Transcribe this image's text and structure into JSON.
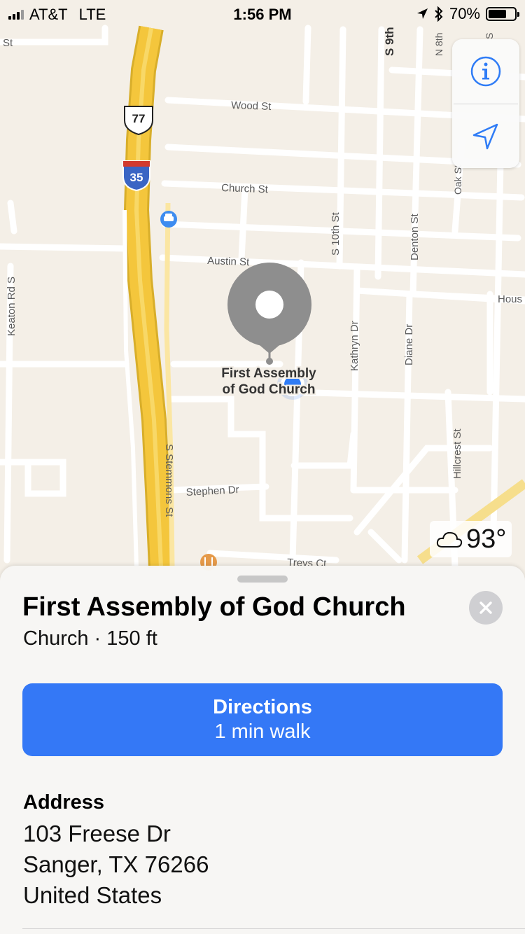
{
  "status_bar": {
    "carrier": "AT&T",
    "network": "LTE",
    "time": "1:56 PM",
    "battery": "70%",
    "battery_level": 0.7,
    "icons": [
      "signal-icon",
      "location-arrow-icon",
      "bluetooth-icon",
      "battery-icon"
    ]
  },
  "map": {
    "street_labels": {
      "st_top_left": "St",
      "s9th": "S 9th",
      "n8th": "N 8th",
      "s_right": "S",
      "wood": "Wood St",
      "church": "Church St",
      "austin": "Austin St",
      "s10th": "S 10th St",
      "denton": "Denton St",
      "oak": "Oak St",
      "hous": "Hous",
      "keaton": "Keaton Rd S",
      "kathryn": "Kathryn Dr",
      "diane": "Diane Dr",
      "hillcrest": "Hillcrest St",
      "stemmons": "S Stemmons St",
      "stephen": "Stephen Dr",
      "treys": "Treys Ct"
    },
    "shields": {
      "us_route": "77",
      "interstate": "35"
    },
    "poi_label_line1": "First Assembly",
    "poi_label_line2": "of God Church",
    "icons": [
      "car-service-icon",
      "restaurant-icon",
      "place-pin-icon",
      "user-location-icon"
    ],
    "colors": {
      "land": "#f4efe7",
      "road": "#ffffff",
      "highway": "#f4c63c",
      "pin": "#8e8e8e",
      "user_dot": "#2f7cf6"
    }
  },
  "controls": {
    "info_icon": "info-icon",
    "location_icon": "location-arrow-icon"
  },
  "weather": {
    "temperature": "93°",
    "icon": "cloud-icon"
  },
  "sheet": {
    "title": "First Assembly of God Church",
    "subtitle": "Church · 150 ft",
    "directions_label": "Directions",
    "directions_detail": "1 min walk",
    "address_label": "Address",
    "address_line1": "103 Freese Dr",
    "address_line2": "Sanger, TX  76266",
    "address_line3": "United States",
    "accent": "#3478f6"
  }
}
